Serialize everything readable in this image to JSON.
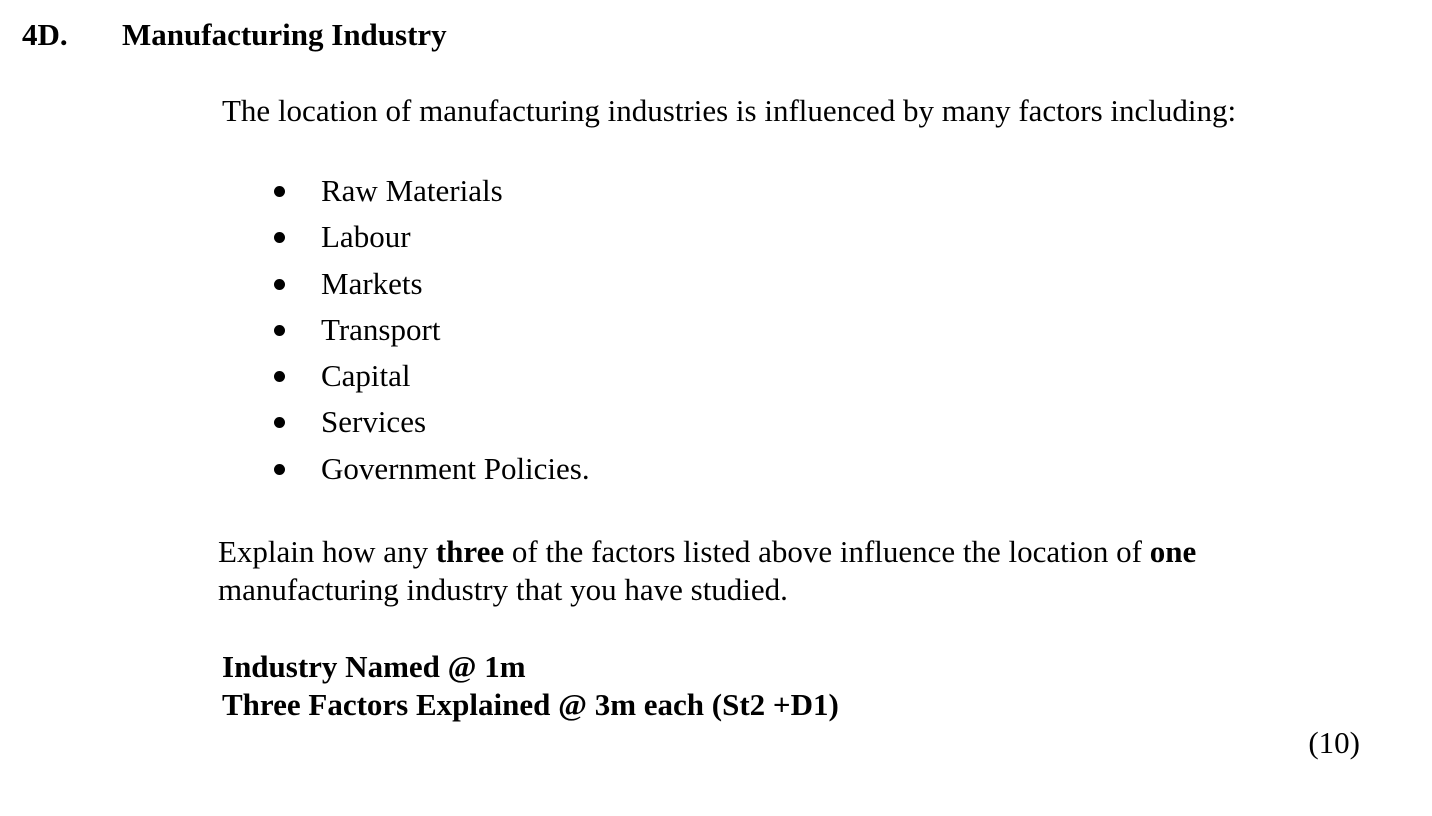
{
  "section": {
    "number": "4D.",
    "title": "Manufacturing Industry"
  },
  "intro": "The location of manufacturing industries is influenced by many factors including:",
  "factors": [
    "Raw Materials",
    "Labour",
    "Markets",
    "Transport",
    "Capital",
    "Services",
    "Government Policies."
  ],
  "question": {
    "part1": "Explain how any ",
    "bold1": "three",
    "part2": " of the factors listed above influence the location of ",
    "bold2": "one",
    "line2": "manufacturing industry that you have studied."
  },
  "marking_scheme": {
    "line1": "Industry Named @ 1m",
    "line2": "Three Factors Explained @ 3m each (St2 +D1)"
  },
  "total_marks": "(10)"
}
